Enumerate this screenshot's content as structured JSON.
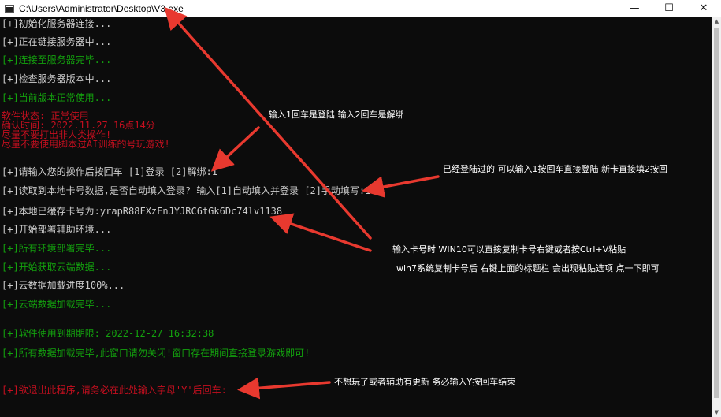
{
  "window": {
    "title": "C:\\Users\\Administrator\\Desktop\\V3.exe",
    "minimize": "—",
    "maximize": "☐",
    "close": "✕"
  },
  "console": {
    "lines": [
      {
        "text": "[+]初始化服务器连接...",
        "color": "white"
      },
      {
        "text": "[+]正在链接服务器中...",
        "color": "white"
      },
      {
        "text": "[+]连接至服务器完毕...",
        "color": "green"
      },
      {
        "text": "[+]检查服务器版本中...",
        "color": "white"
      },
      {
        "text": "[+]当前版本正常使用...",
        "color": "green"
      },
      {
        "text": "软件状态: 正常使用",
        "color": "red"
      },
      {
        "text": "确认时间: 2022.11.27 16点14分",
        "color": "red"
      },
      {
        "text": "尽量不要打出非人类操作!",
        "color": "red"
      },
      {
        "text": "尽量不要使用脚本过AI训练的号玩游戏!",
        "color": "red"
      },
      {
        "text": "[+]请输入您的操作后按回车 [1]登录 [2]解绑:1",
        "color": "white"
      },
      {
        "text": "[+]读取到本地卡号数据,是否自动填入登录? 输入[1]自动填入并登录 [2]手动填写:1",
        "color": "white"
      },
      {
        "text": "[+]本地已缓存卡号为:yrapR88FXzFnJYJRC6tGk6Dc74lv1138",
        "color": "white"
      },
      {
        "text": "[+]开始部署辅助环境...",
        "color": "white"
      },
      {
        "text": "[+]所有环境部署完毕...",
        "color": "green"
      },
      {
        "text": "[+]开始获取云端数据...",
        "color": "green"
      },
      {
        "text": "[+]云数据加载进度100%...",
        "color": "white"
      },
      {
        "text": "[+]云端数据加载完毕...",
        "color": "green"
      },
      {
        "text": "[+]软件使用到期期限: 2022-12-27 16:32:38",
        "color": "green"
      },
      {
        "text": "[+]所有数据加载完毕,此窗口请勿关闭!窗口存在期间直接登录游戏即可!",
        "color": "green"
      },
      {
        "text": "[+]欲退出此程序,请务必在此处输入字母'Y'后回车:",
        "color": "red"
      }
    ]
  },
  "annotations": [
    {
      "text": "输入1回车是登陆 输入2回车是解绑"
    },
    {
      "text": "已经登陆过的 可以输入1按回车直接登陆 新卡直接填2按回"
    },
    {
      "text": "输入卡号时 WIN10可以直接复制卡号右键或者按Ctrl+V粘贴"
    },
    {
      "text": "win7系统复制卡号后 右键上面的标题栏 会出现粘贴选项 点一下即可"
    },
    {
      "text": "不想玩了或者辅助有更新 务必输入Y按回车结束"
    }
  ],
  "colors": {
    "white": "#cccccc",
    "green": "#13a10e",
    "red": "#c50f1f",
    "arrow": "#e8392f"
  }
}
